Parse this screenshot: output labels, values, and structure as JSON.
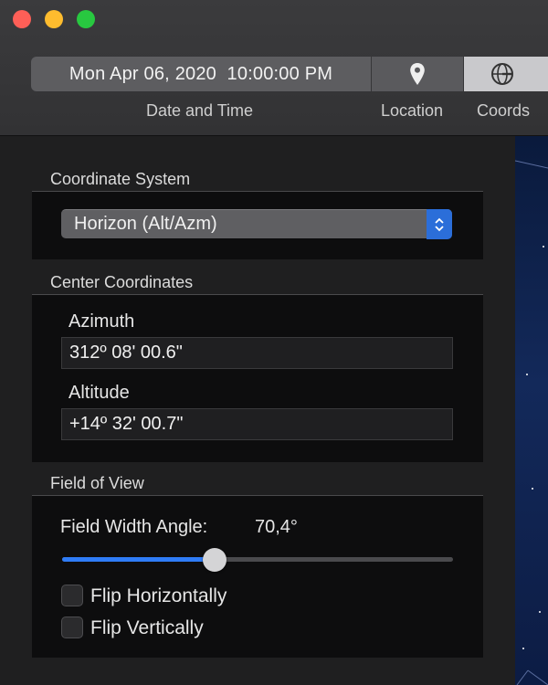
{
  "window": {
    "controls": [
      "close",
      "minimize",
      "zoom"
    ]
  },
  "toolbar": {
    "datetime_value": "Mon Apr 06, 2020  10:00:00 PM",
    "date_time_label": "Date and Time",
    "location_label": "Location",
    "coords_label": "Coords",
    "location_icon": "location-pin-icon",
    "coords_icon": "coordinate-grid-icon",
    "selected_segment": "Coords"
  },
  "coordinate_system": {
    "title": "Coordinate System",
    "selected": "Horizon (Alt/Azm)"
  },
  "center_coordinates": {
    "title": "Center Coordinates",
    "azimuth_label": "Azimuth",
    "azimuth_value": "312º 08' 00.6\"",
    "altitude_label": "Altitude",
    "altitude_value": "+14º 32' 00.7\""
  },
  "field_of_view": {
    "title": "Field of View",
    "width_label": "Field Width Angle:",
    "width_value": "70,4°",
    "slider_fraction": 0.39,
    "flip_horizontal_label": "Flip Horizontally",
    "flip_horizontal_checked": false,
    "flip_vertical_label": "Flip Vertically",
    "flip_vertical_checked": false
  },
  "colors": {
    "accent": "#2f7cf6",
    "stepper": "#2b6ed9",
    "close": "#fe5f57",
    "minimize": "#febc2e",
    "zoom": "#28c840"
  }
}
